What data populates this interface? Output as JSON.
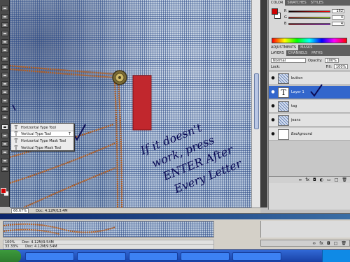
{
  "canvas": {
    "annotation_lines": [
      "If it doesn't",
      "work, press",
      "ENTER After",
      "Every Letter"
    ],
    "status": {
      "zoom": "66.67%",
      "doc_info": "Doc: 4.12M/13.4M"
    }
  },
  "tool_flyout": {
    "items": [
      {
        "label": "Horizontal Type Tool",
        "glyph": "T",
        "key": ""
      },
      {
        "label": "Vertical Type Tool",
        "glyph": "T",
        "key": "T"
      },
      {
        "label": "Horizontal Type Mask Tool",
        "glyph": "T",
        "key": ""
      },
      {
        "label": "Vertical Type Mask Tool",
        "glyph": "T",
        "key": ""
      }
    ]
  },
  "color_panel": {
    "tabs": [
      "COLOR",
      "SWATCHES",
      "STYLES"
    ],
    "channels": [
      {
        "name": "R",
        "value": "162"
      },
      {
        "name": "G",
        "value": "4"
      },
      {
        "name": "B",
        "value": "4"
      }
    ]
  },
  "adjust_tabs": [
    "ADJUSTMENTS",
    "MASKS"
  ],
  "layers_panel": {
    "tabs": [
      "LAYERS",
      "CHANNELS",
      "PATHS"
    ],
    "blend_mode": "Normal",
    "opacity_label": "Opacity:",
    "opacity_value": "100%",
    "fill_label": "Fill:",
    "fill_value": "100%",
    "lock_label": "Lock:",
    "layers": [
      {
        "name": "button",
        "type": "jeans",
        "selected": false,
        "italic": false
      },
      {
        "name": "Layer 1",
        "type": "text",
        "selected": true,
        "italic": false
      },
      {
        "name": "tag",
        "type": "jeans",
        "selected": false,
        "italic": false
      },
      {
        "name": "jeans",
        "type": "jeans",
        "selected": false,
        "italic": false
      },
      {
        "name": "Background",
        "type": "blank",
        "selected": false,
        "italic": true
      }
    ]
  },
  "doc2": {
    "zoom": "100%",
    "doc_info": "Doc: 4.12M/9.54M",
    "zoom_b": "33.33%",
    "doc_info_b": "Doc: 4.12M/9.54M"
  },
  "icons": {
    "fx": "fx",
    "eye": "eye-icon",
    "link": "link-icon",
    "trash": "trash-icon"
  }
}
